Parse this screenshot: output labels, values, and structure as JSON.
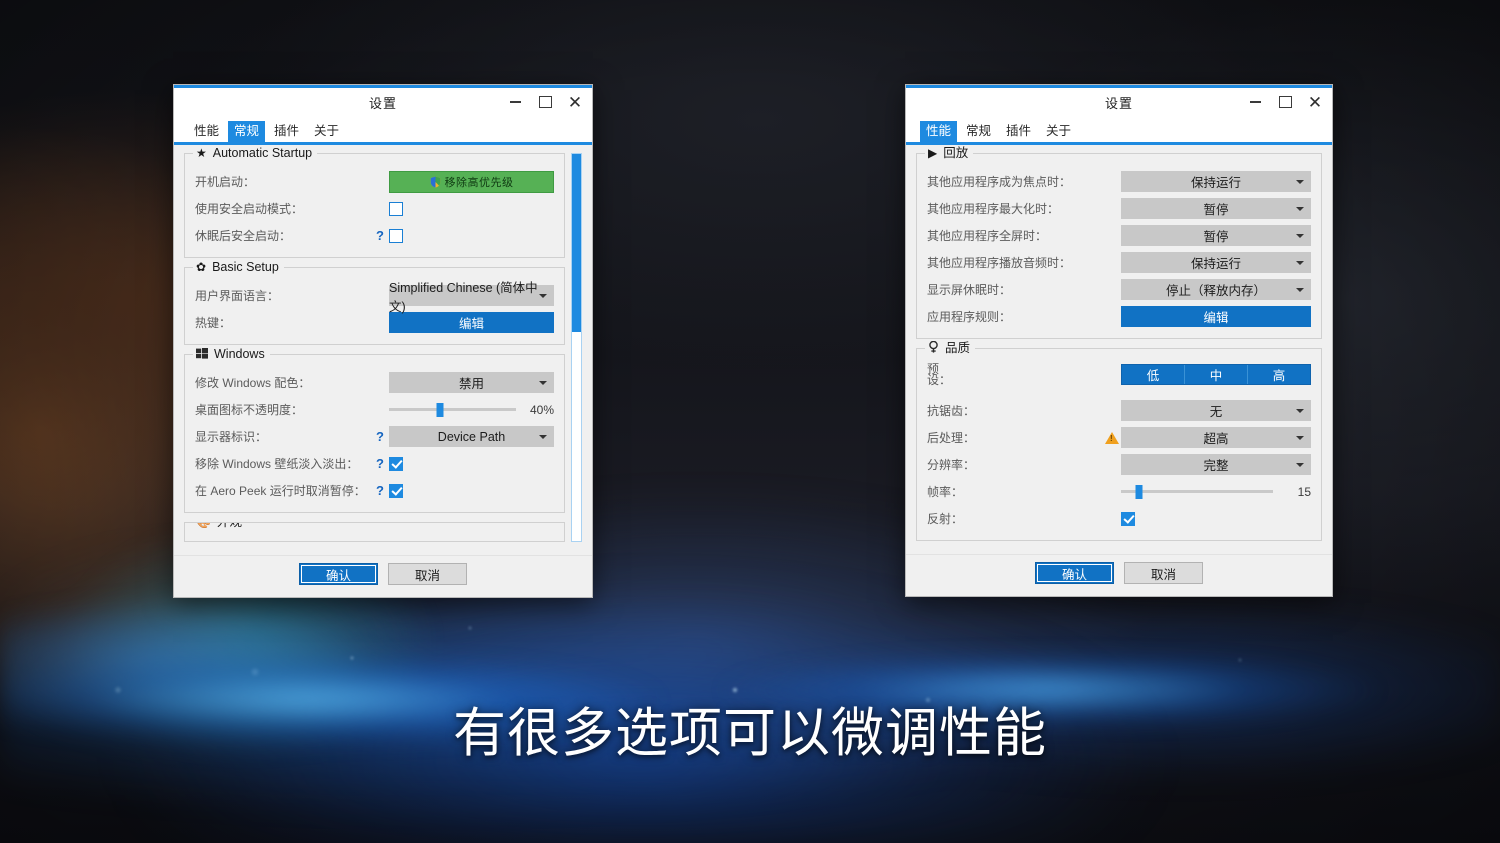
{
  "subtitle": {
    "text": "有很多选项可以微调性能"
  },
  "theme": {
    "accent": "#1e8ae0",
    "button_blue": "#1172c4",
    "green": "#56b155",
    "warning": "#f0a01e",
    "combo_bg": "#c8c8c8",
    "window_bg": "#f0f0f0"
  },
  "window_left": {
    "title": "设置",
    "controls": {
      "minimize": "–",
      "maximize": "□",
      "close": "✕"
    },
    "tabs": [
      {
        "label": "性能",
        "active": false
      },
      {
        "label": "常规",
        "active": true
      },
      {
        "label": "插件",
        "active": false
      },
      {
        "label": "关于",
        "active": false
      }
    ],
    "groups": [
      {
        "title": "Automatic Startup",
        "icon": "star-icon",
        "rows": [
          {
            "label": "开机启动：",
            "help": "",
            "control": "button-green",
            "value": "移除高优先级"
          },
          {
            "label": "使用安全启动模式：",
            "help": "",
            "control": "checkbox",
            "checked": false
          },
          {
            "label": "休眠后安全启动：",
            "help": "?",
            "control": "checkbox",
            "checked": false
          }
        ]
      },
      {
        "title": "Basic Setup",
        "icon": "gear-icon",
        "rows": [
          {
            "label": "用户界面语言：",
            "help": "",
            "control": "combo",
            "value": "Simplified Chinese (简体中文)"
          },
          {
            "label": "热键：",
            "help": "",
            "control": "button-blue",
            "value": "编辑"
          }
        ]
      },
      {
        "title": "Windows",
        "icon": "windows-icon",
        "rows": [
          {
            "label": "修改 Windows 配色：",
            "help": "",
            "control": "combo",
            "value": "禁用"
          },
          {
            "label": "桌面图标不透明度：",
            "help": "",
            "control": "slider",
            "value": "40%",
            "percent": 40
          },
          {
            "label": "显示器标识：",
            "help": "?",
            "control": "combo",
            "value": "Device Path"
          },
          {
            "label": "移除 Windows 壁纸淡入淡出：",
            "help": "?",
            "control": "checkbox",
            "checked": true
          },
          {
            "label": "在 Aero Peek 运行时取消暂停：",
            "help": "?",
            "control": "checkbox",
            "checked": true
          }
        ]
      },
      {
        "title": "外观",
        "icon": "palette-icon",
        "rows": []
      }
    ],
    "footer": {
      "ok": "确认",
      "cancel": "取消"
    },
    "scrollbar": {
      "thumb_top_pct": 0,
      "thumb_height_pct": 46
    }
  },
  "window_right": {
    "title": "设置",
    "controls": {
      "minimize": "–",
      "maximize": "□",
      "close": "✕"
    },
    "tabs": [
      {
        "label": "性能",
        "active": true
      },
      {
        "label": "常规",
        "active": false
      },
      {
        "label": "插件",
        "active": false
      },
      {
        "label": "关于",
        "active": false
      }
    ],
    "groups": [
      {
        "title": "回放",
        "icon": "play-icon",
        "rows": [
          {
            "label": "其他应用程序成为焦点时：",
            "control": "combo",
            "value": "保持运行"
          },
          {
            "label": "其他应用程序最大化时：",
            "control": "combo",
            "value": "暂停"
          },
          {
            "label": "其他应用程序全屏时：",
            "control": "combo",
            "value": "暂停"
          },
          {
            "label": "其他应用程序播放音频时：",
            "control": "combo",
            "value": "保持运行"
          },
          {
            "label": "显示屏休眠时：",
            "control": "combo",
            "value": "停止（释放内存）"
          },
          {
            "label": "应用程序规则：",
            "control": "button-blue",
            "value": "编辑"
          }
        ]
      },
      {
        "title": "品质",
        "icon": "quality-icon",
        "rows": [
          {
            "label": "预设：",
            "control": "segmented",
            "segments": [
              "低",
              "中",
              "高"
            ]
          },
          {
            "label": "抗锯齿：",
            "control": "combo",
            "value": "无"
          },
          {
            "label": "后处理：",
            "control": "combo",
            "value": "超高",
            "warning": true
          },
          {
            "label": "分辨率：",
            "control": "combo",
            "value": "完整"
          },
          {
            "label": "帧率：",
            "control": "slider",
            "value": "15",
            "percent": 12
          },
          {
            "label": "反射：",
            "control": "checkbox",
            "checked": true
          }
        ]
      }
    ],
    "footer": {
      "ok": "确认",
      "cancel": "取消"
    }
  }
}
